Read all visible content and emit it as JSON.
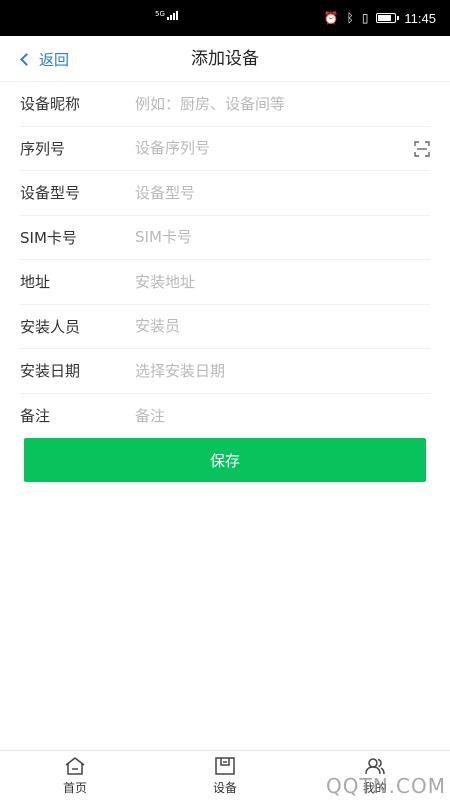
{
  "status_bar": {
    "network": "5G",
    "time": "11:45",
    "battery_level": 0.85,
    "icons": [
      "alarm-icon",
      "bluetooth-icon",
      "vibrate-icon",
      "battery-icon"
    ]
  },
  "header": {
    "back_label": "返回",
    "title": "添加设备"
  },
  "form": {
    "fields": [
      {
        "label": "设备昵称",
        "placeholder": "例如：厨房、设备间等",
        "value": ""
      },
      {
        "label": "序列号",
        "placeholder": "设备序列号",
        "value": ""
      },
      {
        "label": "设备型号",
        "placeholder": "设备型号",
        "value": ""
      },
      {
        "label": "SIM卡号",
        "placeholder": "SIM卡号",
        "value": ""
      },
      {
        "label": "地址",
        "placeholder": "安装地址",
        "value": ""
      },
      {
        "label": "安装人员",
        "placeholder": "安装员",
        "value": ""
      },
      {
        "label": "安装日期",
        "placeholder": "选择安装日期",
        "value": ""
      },
      {
        "label": "备注",
        "placeholder": "备注",
        "value": ""
      }
    ],
    "save_label": "保存"
  },
  "tabbar": {
    "tabs": [
      {
        "label": "首页",
        "icon": "home-icon"
      },
      {
        "label": "设备",
        "icon": "device-icon"
      },
      {
        "label": "我的",
        "icon": "user-icon"
      }
    ]
  },
  "colors": {
    "accent": "#09c25c",
    "link": "#2d7bd6",
    "placeholder": "#b9b9b9"
  },
  "watermark": "QQTN.COM"
}
